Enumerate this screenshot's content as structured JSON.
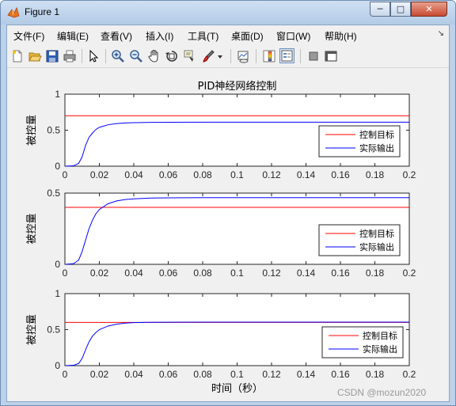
{
  "window": {
    "title": "Figure 1",
    "controls": {
      "minimize": "─",
      "maximize": "□",
      "close": "✕"
    }
  },
  "menu": [
    {
      "label": "文件(F)"
    },
    {
      "label": "编辑(E)"
    },
    {
      "label": "查看(V)"
    },
    {
      "label": "插入(I)"
    },
    {
      "label": "工具(T)"
    },
    {
      "label": "桌面(D)"
    },
    {
      "label": "窗口(W)"
    },
    {
      "label": "帮助(H)"
    }
  ],
  "menu_overflow": "↘",
  "toolbar": [
    "new-figure-icon",
    "open-file-icon",
    "save-icon",
    "print-icon",
    "select-arrow-icon",
    "zoom-in-icon",
    "zoom-out-icon",
    "pan-hand-icon",
    "rotate-3d-icon",
    "data-cursor-icon",
    "brush-icon",
    "brush-dropdown-icon",
    "link-plot-icon",
    "colorbar-icon",
    "legend-icon",
    "hide-plot-tools-icon",
    "show-plot-tools-icon"
  ],
  "colors": {
    "target": "#ff0000",
    "output": "#0000ff",
    "axes_bg": "#ffffff",
    "figure_bg": "#f0f0f0"
  },
  "chart_data": [
    {
      "type": "line",
      "title": "PID神经网络控制",
      "ylabel": "被控量",
      "xlabel": "",
      "xlim": [
        0,
        0.2
      ],
      "ylim": [
        0,
        1
      ],
      "xticks": [
        "0",
        "0.02",
        "0.04",
        "0.06",
        "0.08",
        "0.1",
        "0.12",
        "0.14",
        "0.16",
        "0.18",
        "0.2"
      ],
      "yticks": [
        "0",
        "0.5",
        "1"
      ],
      "legend": [
        "控制目标",
        "实际输出"
      ],
      "legend_position": "lower-right",
      "series": [
        {
          "name": "控制目标",
          "x": [
            0,
            0.2
          ],
          "y": [
            0.7,
            0.7
          ]
        },
        {
          "name": "实际输出",
          "x": [
            0,
            0.005,
            0.008,
            0.01,
            0.012,
            0.014,
            0.016,
            0.018,
            0.02,
            0.025,
            0.03,
            0.035,
            0.04,
            0.05,
            0.06,
            0.08,
            0.1,
            0.15,
            0.2
          ],
          "y": [
            0,
            0.005,
            0.04,
            0.13,
            0.29,
            0.4,
            0.46,
            0.51,
            0.54,
            0.575,
            0.592,
            0.6,
            0.605,
            0.609,
            0.61,
            0.611,
            0.611,
            0.611,
            0.611
          ]
        }
      ]
    },
    {
      "type": "line",
      "title": "",
      "ylabel": "被控量",
      "xlabel": "",
      "xlim": [
        0,
        0.2
      ],
      "ylim": [
        0,
        0.5
      ],
      "xticks": [
        "0",
        "0.02",
        "0.04",
        "0.06",
        "0.08",
        "0.1",
        "0.12",
        "0.14",
        "0.16",
        "0.18",
        "0.2"
      ],
      "yticks": [
        "0",
        "0.5"
      ],
      "legend": [
        "控制目标",
        "实际输出"
      ],
      "legend_position": "lower-right",
      "series": [
        {
          "name": "控制目标",
          "x": [
            0,
            0.2
          ],
          "y": [
            0.4,
            0.4
          ]
        },
        {
          "name": "实际输出",
          "x": [
            0,
            0.005,
            0.008,
            0.01,
            0.012,
            0.014,
            0.016,
            0.018,
            0.02,
            0.025,
            0.03,
            0.035,
            0.04,
            0.05,
            0.06,
            0.08,
            0.1,
            0.15,
            0.2
          ],
          "y": [
            0,
            0.005,
            0.03,
            0.09,
            0.17,
            0.25,
            0.31,
            0.355,
            0.385,
            0.425,
            0.445,
            0.455,
            0.46,
            0.465,
            0.467,
            0.468,
            0.468,
            0.468,
            0.468
          ]
        }
      ]
    },
    {
      "type": "line",
      "title": "",
      "ylabel": "被控量",
      "xlabel": "时间（秒）",
      "xlim": [
        0,
        0.2
      ],
      "ylim": [
        0,
        1
      ],
      "xticks": [
        "0",
        "0.02",
        "0.04",
        "0.06",
        "0.08",
        "0.1",
        "0.12",
        "0.14",
        "0.16",
        "0.18",
        "0.2"
      ],
      "yticks": [
        "0",
        "0.5",
        "1"
      ],
      "legend": [
        "控制目标",
        "实际输出"
      ],
      "legend_position": "lower-right",
      "series": [
        {
          "name": "控制目标",
          "x": [
            0,
            0.2
          ],
          "y": [
            0.6,
            0.6
          ]
        },
        {
          "name": "实际输出",
          "x": [
            0,
            0.005,
            0.008,
            0.01,
            0.012,
            0.014,
            0.016,
            0.018,
            0.02,
            0.025,
            0.03,
            0.035,
            0.04,
            0.045,
            0.05,
            0.06,
            0.08,
            0.1,
            0.15,
            0.2
          ],
          "y": [
            0,
            0.005,
            0.03,
            0.1,
            0.22,
            0.33,
            0.41,
            0.46,
            0.5,
            0.55,
            0.575,
            0.59,
            0.597,
            0.6,
            0.602,
            0.603,
            0.604,
            0.604,
            0.604,
            0.604
          ]
        }
      ]
    }
  ],
  "watermark": "CSDN @mozun2020"
}
